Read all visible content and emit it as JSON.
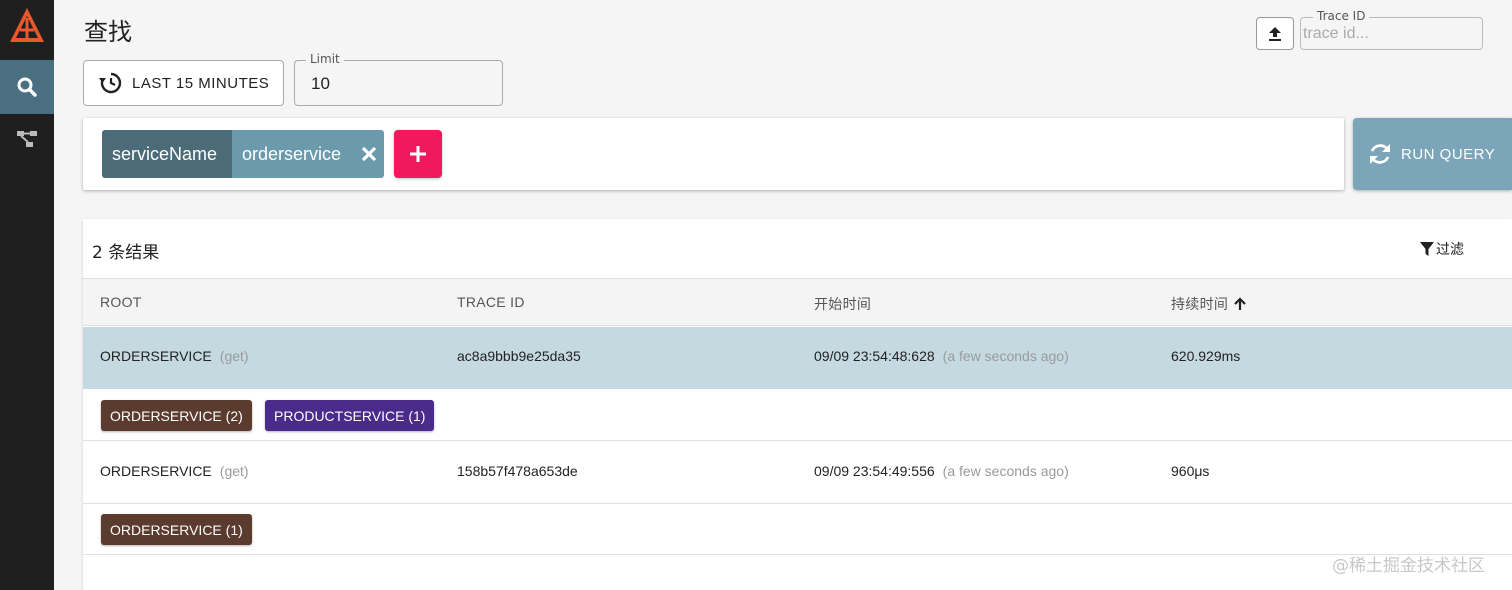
{
  "page": {
    "title": "查找"
  },
  "header": {
    "traceid_label": "Trace ID",
    "traceid_placeholder": "trace id..."
  },
  "controls": {
    "time_range_label": "LAST 15 MINUTES",
    "limit_label": "Limit",
    "limit_value": "10"
  },
  "query": {
    "chip_key": "serviceName",
    "chip_value": "orderservice",
    "run_label": "RUN QUERY"
  },
  "results": {
    "count_label": "2 条结果",
    "filter_label": "过滤",
    "columns": [
      "ROOT",
      "TRACE ID",
      "开始时间",
      "持续时间"
    ],
    "rows": [
      {
        "root": "ORDERSERVICE",
        "method": "(get)",
        "trace_id": "ac8a9bbb9e25da35",
        "start": "09/09 23:54:48:628",
        "relative": "(a few seconds ago)",
        "duration": "620.929ms",
        "tags": [
          "ORDERSERVICE (2)",
          "PRODUCTSERVICE (1)"
        ]
      },
      {
        "root": "ORDERSERVICE",
        "method": "(get)",
        "trace_id": "158b57f478a653de",
        "start": "09/09 23:54:49:556",
        "relative": "(a few seconds ago)",
        "duration": "960μs",
        "tags": [
          "ORDERSERVICE (1)"
        ]
      }
    ]
  },
  "colors": {
    "sidebar": "#1f1f1f",
    "active_nav": "#4a6f80",
    "add_button": "#f0195e",
    "run_button": "#7ca5b9",
    "selected_row": "#c5d9e1",
    "tag_orderservice": "#5a3b2e",
    "tag_productservice": "#4a2a8a"
  },
  "icons": {
    "logo": "zipkin-logo",
    "search": "search-icon",
    "dependencies": "dependencies-icon",
    "upload": "upload-icon",
    "history": "history-icon",
    "close": "close-icon",
    "add": "plus-icon",
    "refresh": "refresh-icon",
    "filter": "filter-icon",
    "sort": "arrow-up-icon"
  },
  "watermark": "@稀土掘金技术社区"
}
